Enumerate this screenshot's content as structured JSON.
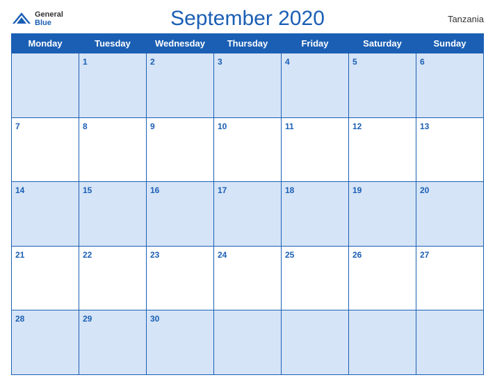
{
  "header": {
    "logo_general": "General",
    "logo_blue": "Blue",
    "title": "September 2020",
    "country": "Tanzania"
  },
  "weekdays": [
    "Monday",
    "Tuesday",
    "Wednesday",
    "Thursday",
    "Friday",
    "Saturday",
    "Sunday"
  ],
  "weeks": [
    [
      {
        "day": "",
        "empty": true
      },
      {
        "day": "1"
      },
      {
        "day": "2"
      },
      {
        "day": "3"
      },
      {
        "day": "4"
      },
      {
        "day": "5"
      },
      {
        "day": "6"
      }
    ],
    [
      {
        "day": "7"
      },
      {
        "day": "8"
      },
      {
        "day": "9"
      },
      {
        "day": "10"
      },
      {
        "day": "11"
      },
      {
        "day": "12"
      },
      {
        "day": "13"
      }
    ],
    [
      {
        "day": "14"
      },
      {
        "day": "15"
      },
      {
        "day": "16"
      },
      {
        "day": "17"
      },
      {
        "day": "18"
      },
      {
        "day": "19"
      },
      {
        "day": "20"
      }
    ],
    [
      {
        "day": "21"
      },
      {
        "day": "22"
      },
      {
        "day": "23"
      },
      {
        "day": "24"
      },
      {
        "day": "25"
      },
      {
        "day": "26"
      },
      {
        "day": "27"
      }
    ],
    [
      {
        "day": "28"
      },
      {
        "day": "29"
      },
      {
        "day": "30"
      },
      {
        "day": "",
        "empty": true
      },
      {
        "day": "",
        "empty": true
      },
      {
        "day": "",
        "empty": true
      },
      {
        "day": "",
        "empty": true
      }
    ]
  ]
}
